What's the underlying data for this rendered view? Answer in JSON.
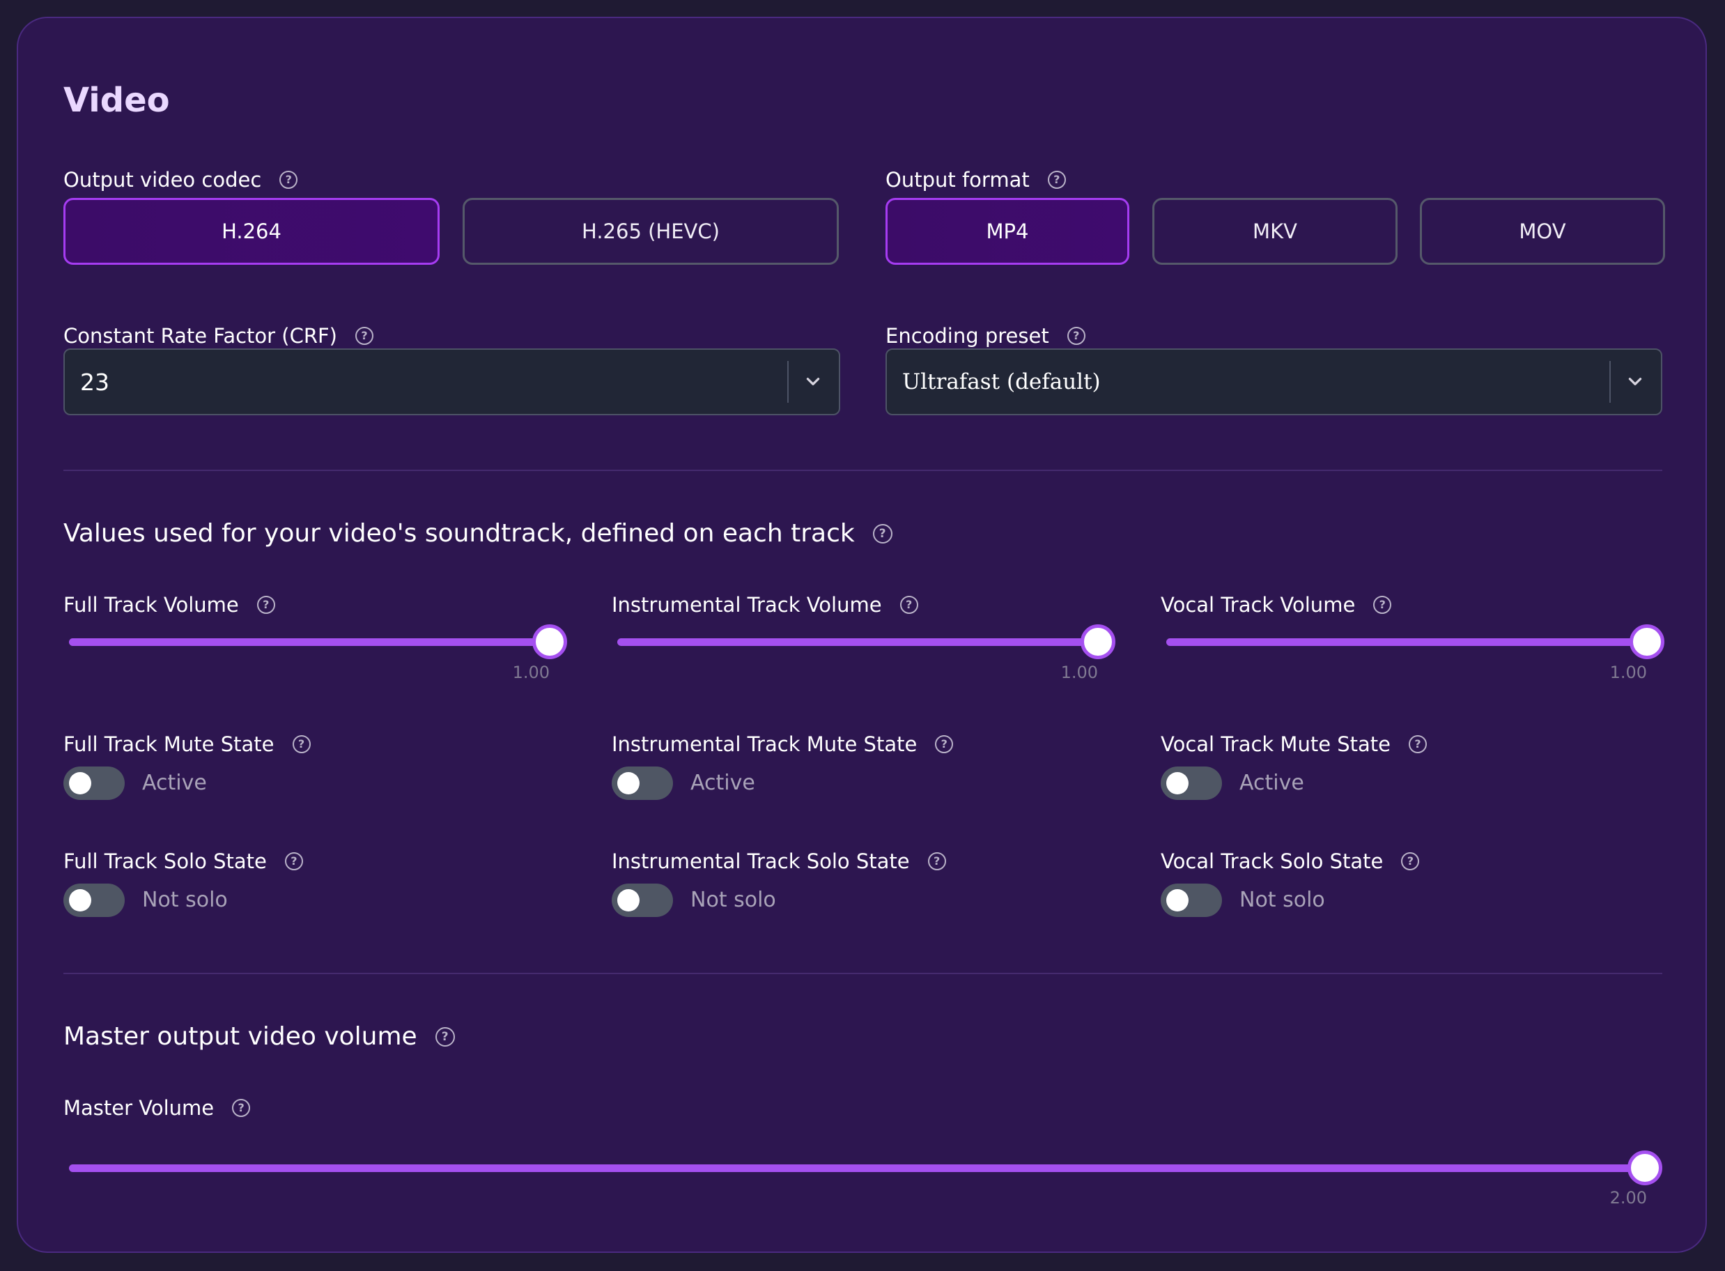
{
  "video": {
    "title": "Video",
    "codec": {
      "label": "Output video codec",
      "options": [
        "H.264",
        "H.265 (HEVC)"
      ],
      "selected": "H.264"
    },
    "format": {
      "label": "Output format",
      "options": [
        "MP4",
        "MKV",
        "MOV"
      ],
      "selected": "MP4"
    },
    "crf": {
      "label": "Constant Rate Factor (CRF)",
      "value": "23"
    },
    "preset": {
      "label": "Encoding preset",
      "value": "Ultrafast (default)"
    }
  },
  "soundtrack": {
    "title": "Values used for your video's soundtrack, defined on each track",
    "tracks": [
      {
        "volume_label": "Full Track Volume",
        "volume_value": "1.00",
        "volume_fraction": 1.0,
        "mute_label": "Full Track Mute State",
        "mute_state": "Active",
        "solo_label": "Full Track Solo State",
        "solo_state": "Not solo"
      },
      {
        "volume_label": "Instrumental Track Volume",
        "volume_value": "1.00",
        "volume_fraction": 1.0,
        "mute_label": "Instrumental Track Mute State",
        "mute_state": "Active",
        "solo_label": "Instrumental Track Solo State",
        "solo_state": "Not solo"
      },
      {
        "volume_label": "Vocal Track Volume",
        "volume_value": "1.00",
        "volume_fraction": 1.0,
        "mute_label": "Vocal Track Mute State",
        "mute_state": "Active",
        "solo_label": "Vocal Track Solo State",
        "solo_state": "Not solo"
      }
    ]
  },
  "master": {
    "title": "Master output video volume",
    "volume_label": "Master Volume",
    "volume_value": "2.00",
    "volume_fraction": 1.0
  },
  "colors": {
    "accent": "#a550f0",
    "selected_border": "#a63cf2",
    "panel_bg": "#2d1650",
    "page_bg": "#1f1a33"
  },
  "icons": {
    "help": "help-circle-icon",
    "dropdown": "chevron-down-icon"
  }
}
